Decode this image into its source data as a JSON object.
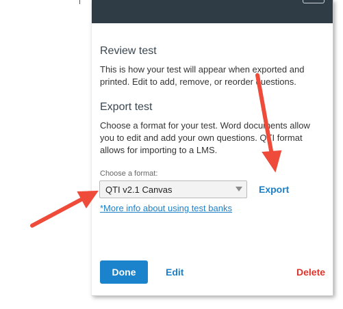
{
  "review": {
    "title": "Review test",
    "body": "This is how your test will appear when exported and printed. Edit to add, remove, or reorder questions."
  },
  "export": {
    "title": "Export test",
    "body": "Choose a format for your test. Word documents allow you to edit and add your own questions. QTI format allows for importing to a LMS.",
    "format_label": "Choose a format:",
    "selected_format": "QTI v2.1 Canvas",
    "export_label": "Export",
    "info_link": "*More info about using test banks"
  },
  "footer": {
    "done_label": "Done",
    "edit_label": "Edit",
    "delete_label": "Delete"
  },
  "colors": {
    "header": "#2f3b45",
    "accent": "#1b82cc",
    "danger": "#d9342b",
    "annotation_arrow": "#ef4b3a"
  }
}
